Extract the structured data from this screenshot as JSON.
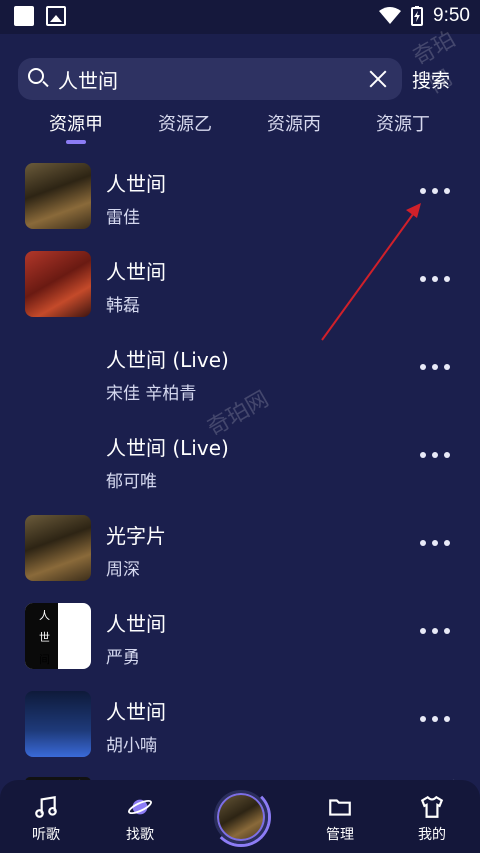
{
  "status_bar": {
    "time": "9:50"
  },
  "search": {
    "query": "人世间",
    "button_label": "搜索"
  },
  "tabs": [
    {
      "label": "资源甲",
      "active": true
    },
    {
      "label": "资源乙",
      "active": false
    },
    {
      "label": "资源丙",
      "active": false
    },
    {
      "label": "资源丁",
      "active": false
    }
  ],
  "songs": [
    {
      "title": "人世间",
      "artist": "雷佳",
      "cover": "cover-a"
    },
    {
      "title": "人世间",
      "artist": "韩磊",
      "cover": "cover-b"
    },
    {
      "title": "人世间 (Live)",
      "artist": "宋佳  辛柏青",
      "cover": ""
    },
    {
      "title": "人世间 (Live)",
      "artist": "郁可唯",
      "cover": ""
    },
    {
      "title": "光字片",
      "artist": "周深",
      "cover": "cover-a"
    },
    {
      "title": "人世间",
      "artist": "严勇",
      "cover": "cover-c"
    },
    {
      "title": "人世间",
      "artist": "胡小喃",
      "cover": "cover-d"
    }
  ],
  "cover_text": {
    "c_chars": [
      "人",
      "世",
      "间"
    ]
  },
  "bottom_nav": [
    {
      "label": "听歌",
      "icon": "music-note-icon"
    },
    {
      "label": "找歌",
      "icon": "planet-icon"
    },
    {
      "label": "",
      "icon": "now-playing-disc"
    },
    {
      "label": "管理",
      "icon": "folder-icon"
    },
    {
      "label": "我的",
      "icon": "shirt-icon"
    }
  ],
  "watermark": "奇珀网",
  "colors": {
    "background": "#1b1f4d",
    "accent": "#8c7cf5",
    "arrow": "#d0202a"
  }
}
